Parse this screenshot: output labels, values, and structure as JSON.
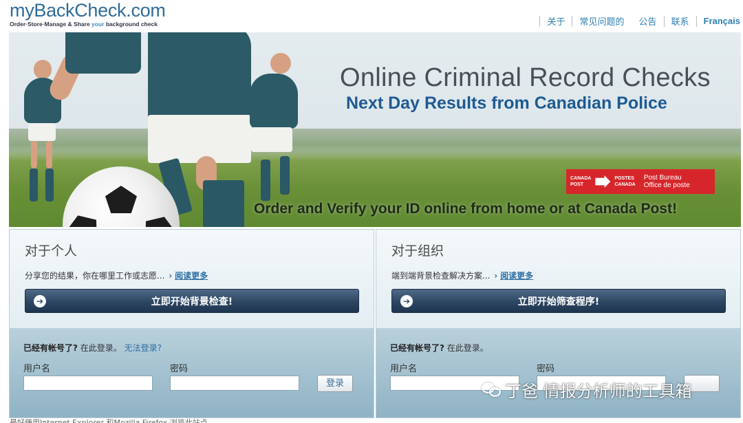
{
  "header": {
    "logo_text": "myBackCheck.com",
    "tagline_part1": "Order·Store·Manage & Share ",
    "tagline_your": "your",
    "tagline_part2": " background check",
    "nav": [
      {
        "label": "关于"
      },
      {
        "label": "常见问题的"
      },
      {
        "label": "公告"
      },
      {
        "label": "联系"
      },
      {
        "label": "Français"
      }
    ]
  },
  "banner": {
    "headline": "Online Criminal Record Checks",
    "subheadline": "Next Day Results from Canadian Police",
    "canada_post": {
      "left_line1": "CANADA",
      "left_line2": "POST",
      "mid_line1": "POSTES",
      "mid_line2": "CANADA",
      "right_line1": "Post   Bureau",
      "right_line2": "Office  de poste"
    },
    "tagline": "Order and Verify your ID online from home or at Canada Post!"
  },
  "panels": {
    "individual": {
      "title": "对于个人",
      "description": "分享您的结果，你在哪里工作或志愿...",
      "read_more": "阅读更多",
      "cta": "立即开始背景检查!",
      "login_question": "已经有帐号了?",
      "login_text": " 在此登录。",
      "cant_login": "无法登录?",
      "username_label": "用户名",
      "password_label": "密码",
      "login_button": "登录"
    },
    "organization": {
      "title": "对于组织",
      "description": "端到端背景检查解决方案...",
      "read_more": "阅读更多",
      "cta": "立即开始筛查程序!",
      "login_question": "已经有帐号了?",
      "login_text": " 在此登录。",
      "username_label": "用户名",
      "password_label": "密码"
    }
  },
  "watermark": "丁爸 情报分析师的工具箱",
  "footer_note": "最好使用Internet Explorer 和Mozilla Firefox 浏览此站点"
}
